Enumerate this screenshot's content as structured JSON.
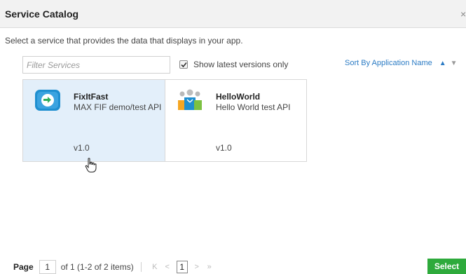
{
  "header": {
    "title": "Service Catalog",
    "close_glyph": "×"
  },
  "instructions": "Select a service that provides the data that displays in your app.",
  "filter": {
    "placeholder": "Filter Services",
    "value": ""
  },
  "latest_toggle": {
    "label": "Show latest versions only",
    "checked": true
  },
  "sort": {
    "label": "Sort By Application Name",
    "up": "▲",
    "down": "▼"
  },
  "services": [
    {
      "name": "FixItFast",
      "description": "MAX FIF demo/test API",
      "version": "v1.0",
      "icon": "fixitfast-icon",
      "selected": true
    },
    {
      "name": "HelloWorld",
      "description": "Hello World test API",
      "version": "v1.0",
      "icon": "helloworld-icon",
      "selected": false
    }
  ],
  "pager": {
    "label": "Page",
    "page_input": "1",
    "of_text": "of 1 (1-2 of 2 items)",
    "first": "K",
    "prev": "<",
    "current": "1",
    "next": ">",
    "last": "»"
  },
  "select_button": "Select",
  "colors": {
    "accent": "#2b7bc4",
    "selected_bg": "#e3effa",
    "select_green": "#2eaa3c"
  }
}
